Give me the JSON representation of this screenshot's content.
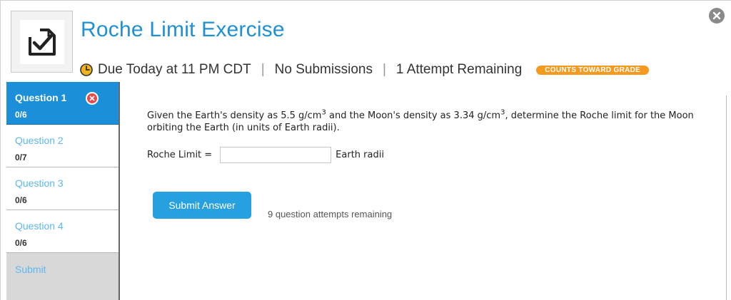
{
  "assignment": {
    "title": "Roche Limit Exercise",
    "due": "Due Today at 11 PM CDT",
    "separator": "|",
    "submissions": "No Submissions",
    "attempts_remaining": "1 Attempt Remaining",
    "badge": "COUNTS TOWARD GRADE"
  },
  "sidebar": {
    "questions": [
      {
        "label": "Question 1",
        "score": "0/6"
      },
      {
        "label": "Question 2",
        "score": "0/7"
      },
      {
        "label": "Question 3",
        "score": "0/6"
      },
      {
        "label": "Question 4",
        "score": "0/6"
      }
    ],
    "submit_label": "Submit"
  },
  "question": {
    "text_part1": "Given the Earth's density as 5.5 g/cm",
    "sup1": "3",
    "text_part2": " and the Moon's density as 3.34 g/cm",
    "sup2": "3",
    "text_part3": ", determine the Roche limit for the Moon orbiting the Earth (in units of Earth radii).",
    "answer_label": "Roche Limit =",
    "answer_value": "",
    "answer_unit": "Earth radii"
  },
  "actions": {
    "submit_answer": "Submit Answer",
    "question_attempts": "9 question attempts remaining"
  },
  "colors": {
    "accent": "#1e90d4",
    "active_tab": "#1b8fd8",
    "badge": "#f59a20",
    "error": "#e8494a"
  },
  "icons": {
    "close": "close-icon",
    "assignment": "checklist-icon",
    "due": "clock-icon",
    "incorrect": "x-circle-icon"
  }
}
